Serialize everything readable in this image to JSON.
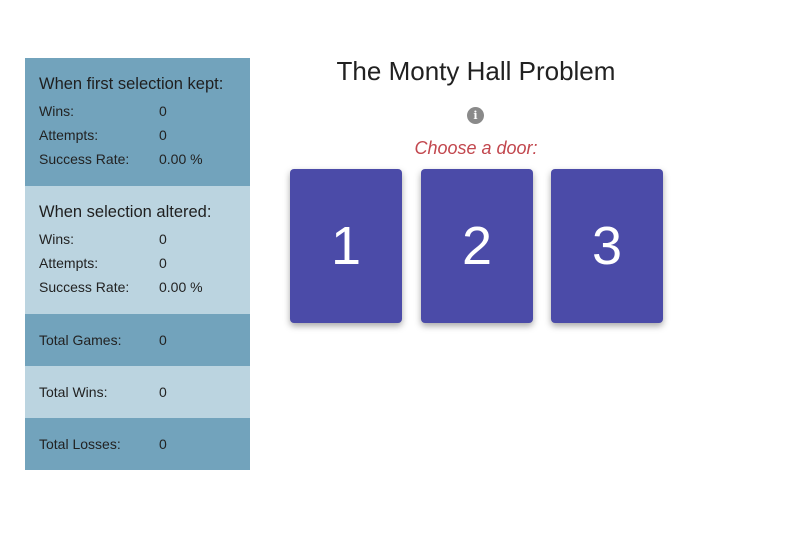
{
  "stats": {
    "kept": {
      "heading": "When first selection kept:",
      "wins_label": "Wins:",
      "wins": "0",
      "attempts_label": "Attempts:",
      "attempts": "0",
      "rate_label": "Success Rate:",
      "rate": "0.00 %"
    },
    "altered": {
      "heading": "When selection altered:",
      "wins_label": "Wins:",
      "wins": "0",
      "attempts_label": "Attempts:",
      "attempts": "0",
      "rate_label": "Success Rate:",
      "rate": "0.00 %"
    },
    "total_games_label": "Total Games:",
    "total_games": "0",
    "total_wins_label": "Total Wins:",
    "total_wins": "0",
    "total_losses_label": "Total Losses:",
    "total_losses": "0"
  },
  "main": {
    "title": "The Monty Hall Problem",
    "info_icon": "i",
    "prompt": "Choose a door:",
    "doors": [
      "1",
      "2",
      "3"
    ]
  },
  "colors": {
    "dark_panel": "#72a3bc",
    "light_panel": "#bbd4e0",
    "door": "#4b4ba8",
    "prompt": "#c2474e"
  }
}
